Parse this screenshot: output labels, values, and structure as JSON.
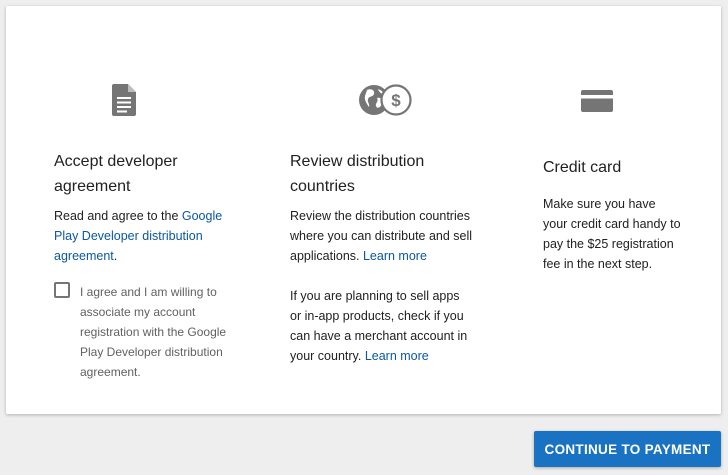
{
  "sections": [
    {
      "icon": "document-icon",
      "title": "Accept developer agreement",
      "body_prefix": "Read and agree to the ",
      "body_link": "Google Play Developer distribution agreement",
      "body_suffix": ".",
      "checkbox_checked": false,
      "checkbox_label": "I agree and I am willing to associate my account registration with the Google Play Developer distribution agreement."
    },
    {
      "icon": "globe-dollar-icon",
      "title": "Review distribution countries",
      "body1_text": "Review the distribution countries where you can distribute and sell applications. ",
      "body1_link": "Learn more",
      "body2_text": "If you are planning to sell apps or in-app products, check if you can have a merchant account in your country. ",
      "body2_link": "Learn more"
    },
    {
      "icon": "credit-card-icon",
      "title": "Credit card",
      "body": "Make sure you have your credit card handy to pay the $25 registration fee in the next step."
    }
  ],
  "continue_button": "CONTINUE TO PAYMENT",
  "colors": {
    "accent": "#1a73c2",
    "link": "#0b57a3",
    "icon": "#757575"
  }
}
